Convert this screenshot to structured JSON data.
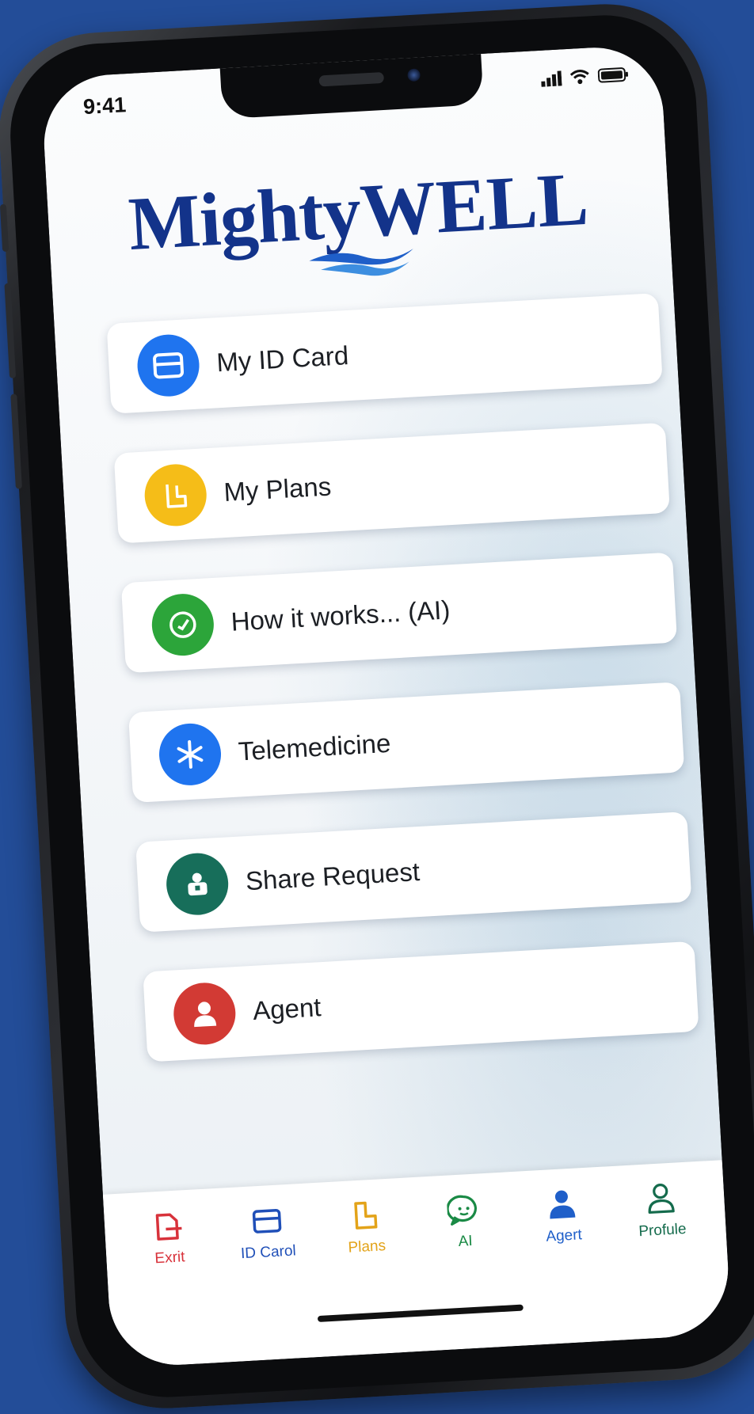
{
  "status_bar": {
    "time": "9:41"
  },
  "brand": {
    "name_part1": "Mighty",
    "name_part2": "WELL",
    "color": "#13338a"
  },
  "menu": {
    "items": [
      {
        "label": "My ID Card",
        "icon": "id-card-icon",
        "color": "#1f74ef"
      },
      {
        "label": "My Plans",
        "icon": "plans-icon",
        "color": "#f5bd18"
      },
      {
        "label": "How it works... (AI)",
        "icon": "clock-icon",
        "color": "#2ca53a"
      },
      {
        "label": "Telemedicine",
        "icon": "asterisk-icon",
        "color": "#1f74ef"
      },
      {
        "label": "Share Request",
        "icon": "share-request-icon",
        "color": "#176e5a"
      },
      {
        "label": "Agent",
        "icon": "person-icon",
        "color": "#d23a34"
      }
    ]
  },
  "tab_bar": {
    "tabs": [
      {
        "label": "Exrit",
        "icon": "exit-icon",
        "color": "#d8323b"
      },
      {
        "label": "ID Carol",
        "icon": "id-card-icon",
        "color": "#1f4fb8"
      },
      {
        "label": "Plans",
        "icon": "plans-icon",
        "color": "#e3a319"
      },
      {
        "label": "AI",
        "icon": "chat-icon",
        "color": "#1a8a45"
      },
      {
        "label": "Agert",
        "icon": "person-icon",
        "color": "#1f5fc9"
      },
      {
        "label": "Profule",
        "icon": "profile-icon",
        "color": "#146b4c"
      }
    ]
  }
}
